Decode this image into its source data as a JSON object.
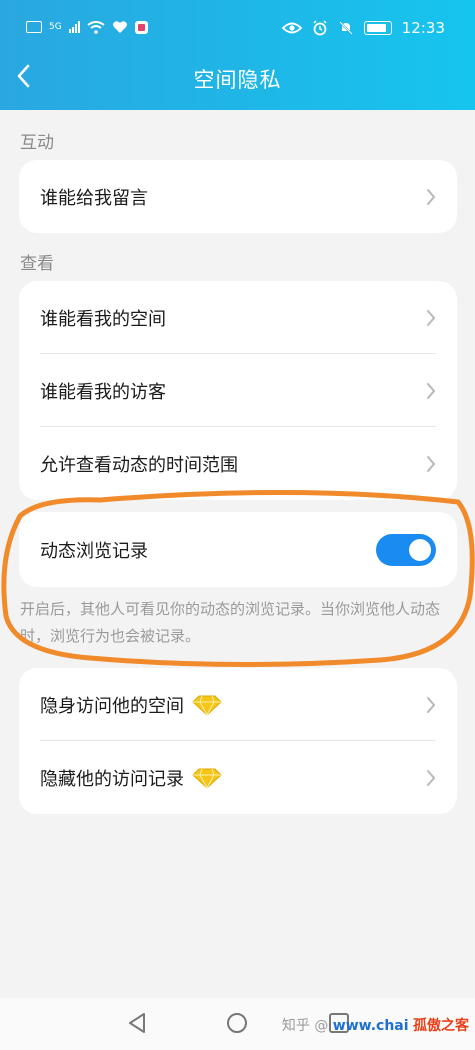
{
  "status_bar": {
    "left_icons": [
      "hd-icon",
      "5g-signal-icon",
      "wifi-icon",
      "heart-icon",
      "app-icon"
    ],
    "network_label": "5G",
    "time": "12:33"
  },
  "header": {
    "title": "空间隐私"
  },
  "sections": {
    "interact_label": "互动",
    "view_label": "查看"
  },
  "interact_items": [
    {
      "label": "谁能给我留言"
    }
  ],
  "view_items": [
    {
      "label": "谁能看我的空间"
    },
    {
      "label": "谁能看我的访客"
    },
    {
      "label": "允许查看动态的时间范围"
    }
  ],
  "toggle_item": {
    "label": "动态浏览记录",
    "enabled": true,
    "description": "开启后，其他人可看见你的动态的浏览记录。当你浏览他人动态时，浏览行为也会被记录。"
  },
  "vip_items": [
    {
      "label": "隐身访问他的空间",
      "icon": "diamond-icon"
    },
    {
      "label": "隐藏他的访问记录",
      "icon": "diamond-icon"
    }
  ],
  "watermark": {
    "text1": "知乎 @",
    "site": "www.chai",
    "brand": "孤傲之客"
  },
  "colors": {
    "accent": "#1a8bf0",
    "header_gradient_start": "#2aa7e0",
    "header_gradient_end": "#16c5ee",
    "highlight": "#f08a2a",
    "diamond": "#f5c518"
  }
}
